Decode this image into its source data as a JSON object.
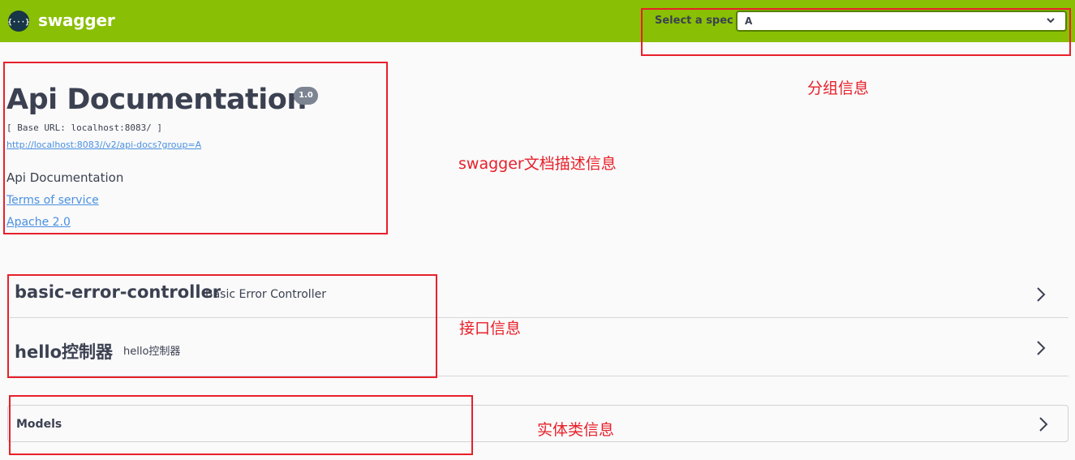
{
  "topbar": {
    "logo_symbol": "{···}",
    "logo_text": "swagger",
    "spec_label": "Select a spec",
    "spec_selected": "A",
    "brand_color": "#89bf04"
  },
  "info": {
    "title": "Api Documentation",
    "version": "1.0",
    "base_url": "[ Base URL: localhost:8083/ ]",
    "docs_link": "http://localhost:8083//v2/api-docs?group=A",
    "description": "Api Documentation",
    "terms_link": "Terms of service",
    "license_link": "Apache 2.0"
  },
  "tags": [
    {
      "name": "basic-error-controller",
      "description": "Basic Error Controller"
    },
    {
      "name": "hello控制器",
      "description": "hello控制器"
    }
  ],
  "models": {
    "label": "Models"
  },
  "annotations": {
    "group_info": "分组信息",
    "doc_info": "swagger文档描述信息",
    "api_info": "接口信息",
    "entity_info": "实体类信息",
    "color": "#e8202a"
  }
}
